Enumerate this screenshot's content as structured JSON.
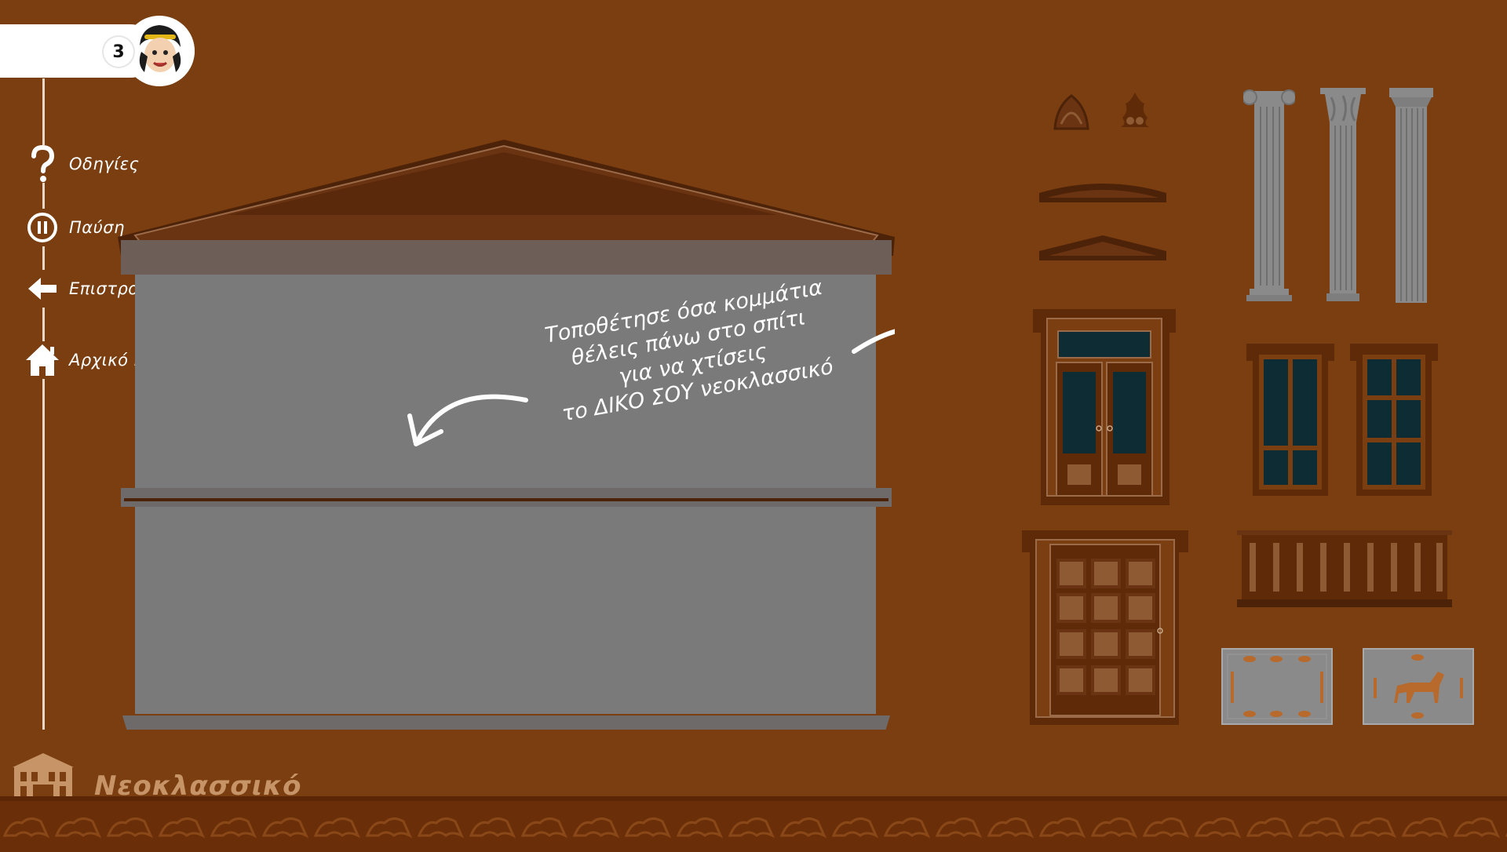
{
  "player": {
    "lives": "3"
  },
  "menu": [
    {
      "label": "Οδηγίες",
      "icon": "question-icon"
    },
    {
      "label": "Παύση",
      "icon": "pause-icon"
    },
    {
      "label": "Επιστροφή",
      "icon": "back-arrow-icon"
    },
    {
      "label": "Αρχικό menu",
      "icon": "home-icon"
    }
  ],
  "instructions": {
    "line1": "Τοποθέτησε όσα κομμάτια",
    "line2": "θέλεις πάνω στο σπίτι",
    "line3": "για να χτίσεις",
    "line4": "το ΔΙΚΟ ΣΟΥ νεοκλασσικό"
  },
  "footer": {
    "title": "Νεοκλασσικό",
    "icon": "neoclassical-building-icon"
  },
  "colors": {
    "background": "#7a3e10",
    "wall": "#7a7a7a",
    "wood": "#5e2a07",
    "glass": "#0d2c33",
    "column": "#8a8a8a"
  }
}
